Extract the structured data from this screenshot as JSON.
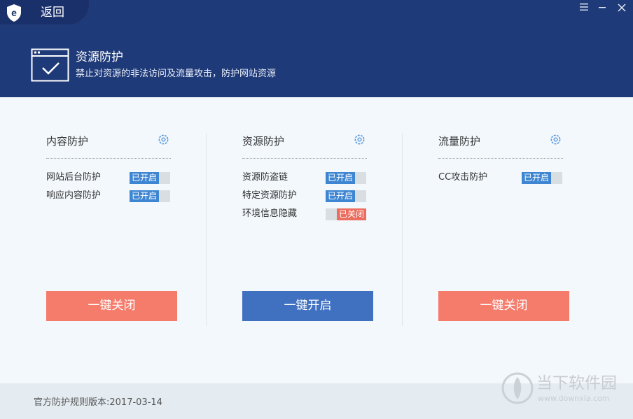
{
  "header": {
    "back_label": "返回",
    "feature_title": "资源防护",
    "feature_desc": "禁止对资源的非法访问及流量攻击，防护网站资源"
  },
  "window_controls": [
    "menu-icon",
    "minimize-icon",
    "close-icon"
  ],
  "columns": [
    {
      "title": "内容防护",
      "items": [
        {
          "label": "网站后台防护",
          "status": "已开启",
          "on": true
        },
        {
          "label": "响应内容防护",
          "status": "已开启",
          "on": true
        }
      ],
      "button": "一键关闭"
    },
    {
      "title": "资源防护",
      "items": [
        {
          "label": "资源防盗链",
          "status": "已开启",
          "on": true
        },
        {
          "label": "特定资源防护",
          "status": "已开启",
          "on": true
        },
        {
          "label": "环境信息隐藏",
          "status": "已关闭",
          "on": false
        }
      ],
      "button": "一键开启"
    },
    {
      "title": "流量防护",
      "items": [
        {
          "label": "CC攻击防护",
          "status": "已开启",
          "on": true
        }
      ],
      "button": "一键关闭"
    }
  ],
  "footer": {
    "version": "官方防护规则版本:2017-03-14"
  },
  "watermark": {
    "title": "当下软件园",
    "url": "www.downxia.com"
  },
  "colors": {
    "header_bg": "#1f3a78",
    "on": "#3f86d2",
    "off": "#ec6c5d",
    "btn_red": "#f57b6b",
    "btn_blue": "#4070c0"
  }
}
